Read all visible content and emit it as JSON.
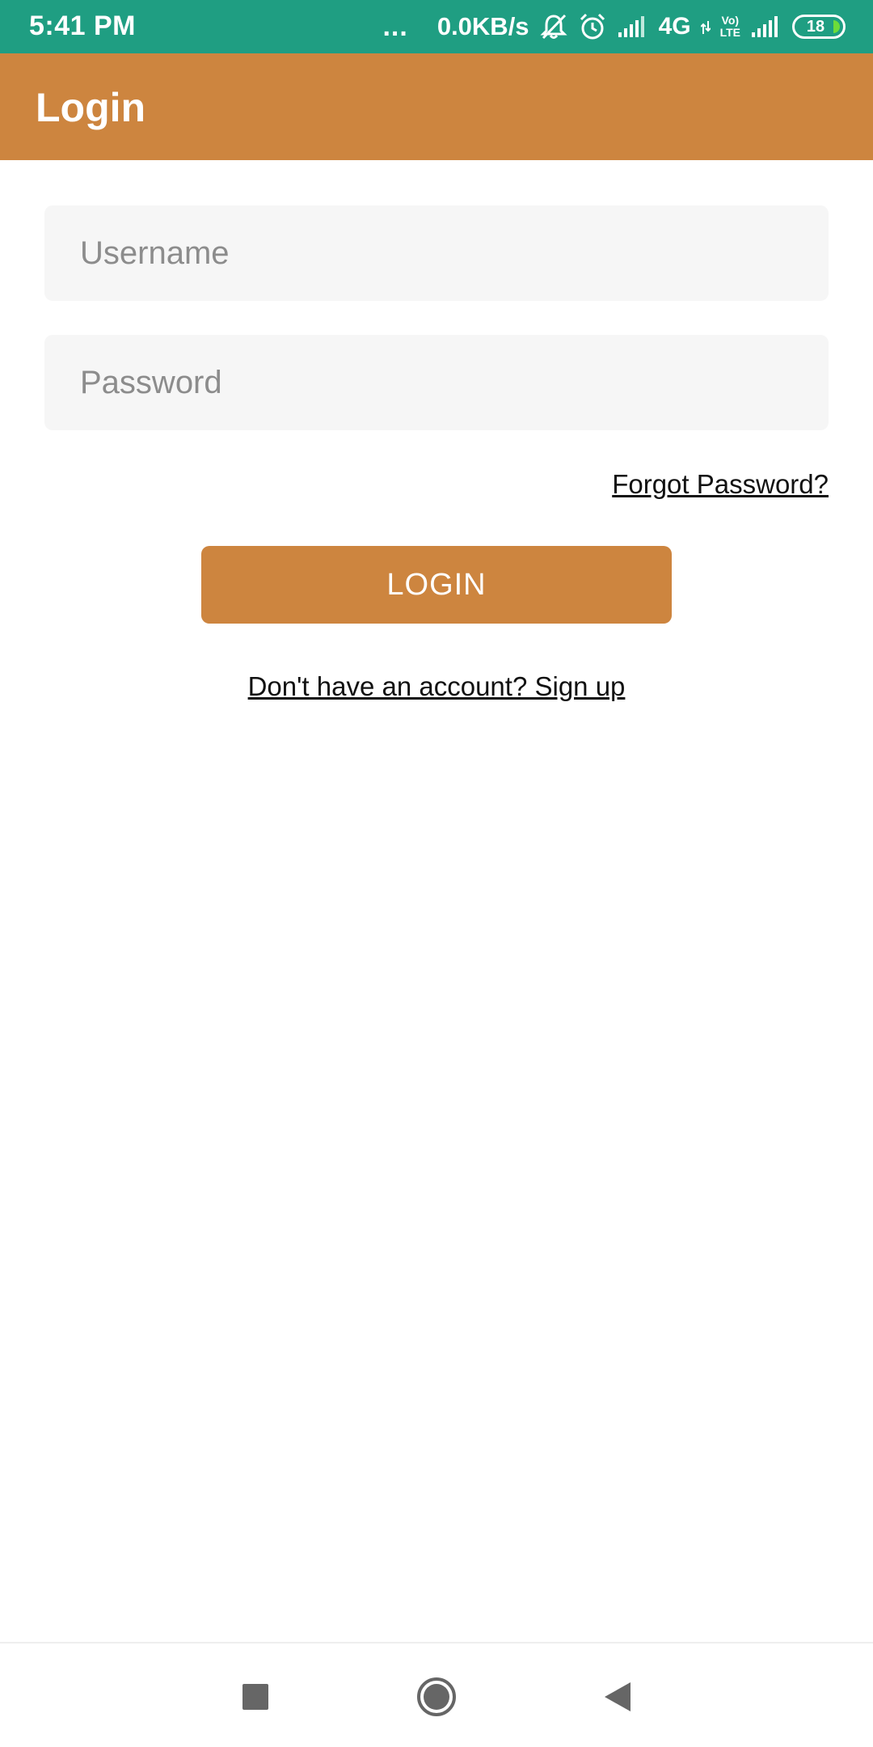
{
  "status_bar": {
    "time": "5:41 PM",
    "dots": "...",
    "speed": "0.0KB/s",
    "network_type": "4G",
    "volte_top": "Vo)",
    "volte_bottom": "LTE",
    "battery_level": "18",
    "battery_fill_color": "#6ddc3a",
    "icons": [
      "mute-icon",
      "alarm-icon",
      "signal-icon",
      "data-arrows-icon",
      "volte-icon",
      "signal-icon",
      "battery-icon"
    ]
  },
  "colors": {
    "status_bar": "#1f9e82",
    "accent": "#cd853f",
    "field_background": "#f6f6f6"
  },
  "app_bar": {
    "title": "Login"
  },
  "form": {
    "username": {
      "value": "",
      "placeholder": "Username"
    },
    "password": {
      "value": "",
      "placeholder": "Password"
    },
    "forgot_password": "Forgot Password?",
    "login_button": "LOGIN",
    "signup_prompt": "Don't have an account? Sign up"
  },
  "nav_bar": {
    "buttons": [
      "recents-icon",
      "home-icon",
      "back-icon"
    ]
  }
}
